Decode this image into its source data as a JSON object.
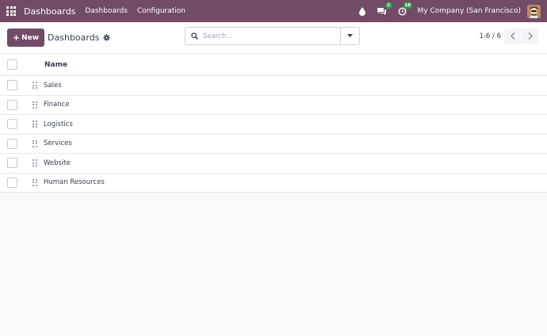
{
  "navbar": {
    "brand": "Dashboards",
    "menus": [
      "Dashboards",
      "Configuration"
    ],
    "messages_badge": "2",
    "activities_badge": "18",
    "company": "My Company (San Francisco)"
  },
  "control": {
    "new_label": "New",
    "breadcrumb": "Dashboards",
    "search_placeholder": "Search...",
    "pager": "1-6 / 6"
  },
  "list": {
    "column_header": "Name",
    "rows": [
      "Sales",
      "Finance",
      "Logistics",
      "Services",
      "Website",
      "Human Resources"
    ]
  },
  "colors": {
    "brand": "#714b67",
    "badge": "#28a745"
  }
}
